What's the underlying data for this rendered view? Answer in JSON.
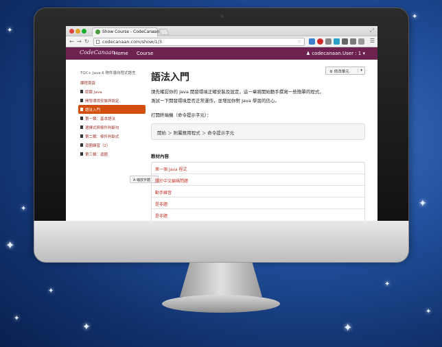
{
  "browser": {
    "tab_title": "Show Course - CodeCanaan",
    "url": "codecanaan.com/show/1/3"
  },
  "site": {
    "logo": "CodeCanaan",
    "nav": [
      "Home",
      "Course"
    ],
    "user": "codecanaan.User : 1"
  },
  "sidebar": {
    "heading": "TQC+ Java 6 物件導向程式語言",
    "items": [
      {
        "label": "課程首頁",
        "active": false,
        "book": false
      },
      {
        "label": "認識 Java",
        "active": false,
        "book": true
      },
      {
        "label": "開發環境安裝與設定",
        "active": false,
        "book": true
      },
      {
        "label": "語法入門",
        "active": true,
        "book": true
      },
      {
        "label": "第一類：基本語法",
        "active": false,
        "book": true
      },
      {
        "label": "選擇式與條件判斷句",
        "active": false,
        "book": true
      },
      {
        "label": "第二類：條件判斷式",
        "active": false,
        "book": true
      },
      {
        "label": "迴圈練習（2）",
        "active": false,
        "book": true
      },
      {
        "label": "第三類：迴圈",
        "active": false,
        "book": true
      }
    ],
    "font_button": "A 縮放字體"
  },
  "main": {
    "title": "語法入門",
    "settings_button": "修改單元",
    "intro_line1": "請先確認你的 Java 開發環境正確安裝及設定，這一章將開始動手撰寫一些簡單的程式，",
    "intro_line2": "測試一下開發環境是否正常運作，並增加你對 Java 學習的信心。",
    "instruction": "打開終端機（命令提示字元）：",
    "path": "開始 ＞ 附屬應用程式 ＞ 命令提示字元",
    "contents_title": "教材內容",
    "contents": [
      "第一個 Java 程式",
      "關於中文編碼問題",
      "動手練習",
      "是非題",
      "是非題"
    ]
  }
}
